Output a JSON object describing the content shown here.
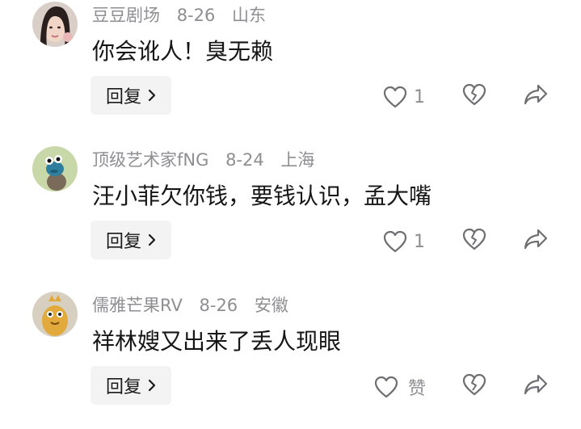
{
  "comments": [
    {
      "username": "豆豆剧场",
      "date": "8-26",
      "location": "山东",
      "text": "你会讹人！臭无赖",
      "reply_label": "回复",
      "like_count": "1",
      "liked_state": "count"
    },
    {
      "username": "顶级艺术家fNG",
      "date": "8-24",
      "location": "上海",
      "text": "汪小菲欠你钱，要钱认识，孟大嘴",
      "reply_label": "回复",
      "like_count": "1",
      "liked_state": "count"
    },
    {
      "username": "儒雅芒果RV",
      "date": "8-26",
      "location": "安徽",
      "text": "祥林嫂又出来了丢人现眼",
      "reply_label": "回复",
      "like_count": "赞",
      "liked_state": "label"
    }
  ],
  "icons": {
    "like": "heart-outline-icon",
    "dislike": "broken-heart-icon",
    "share": "share-arrow-icon",
    "reply_chevron": "chevron-right-icon"
  },
  "colors": {
    "text": "#161616",
    "meta": "#8e8e93",
    "button_bg": "#f3f3f3",
    "icon": "#6e6e73"
  }
}
